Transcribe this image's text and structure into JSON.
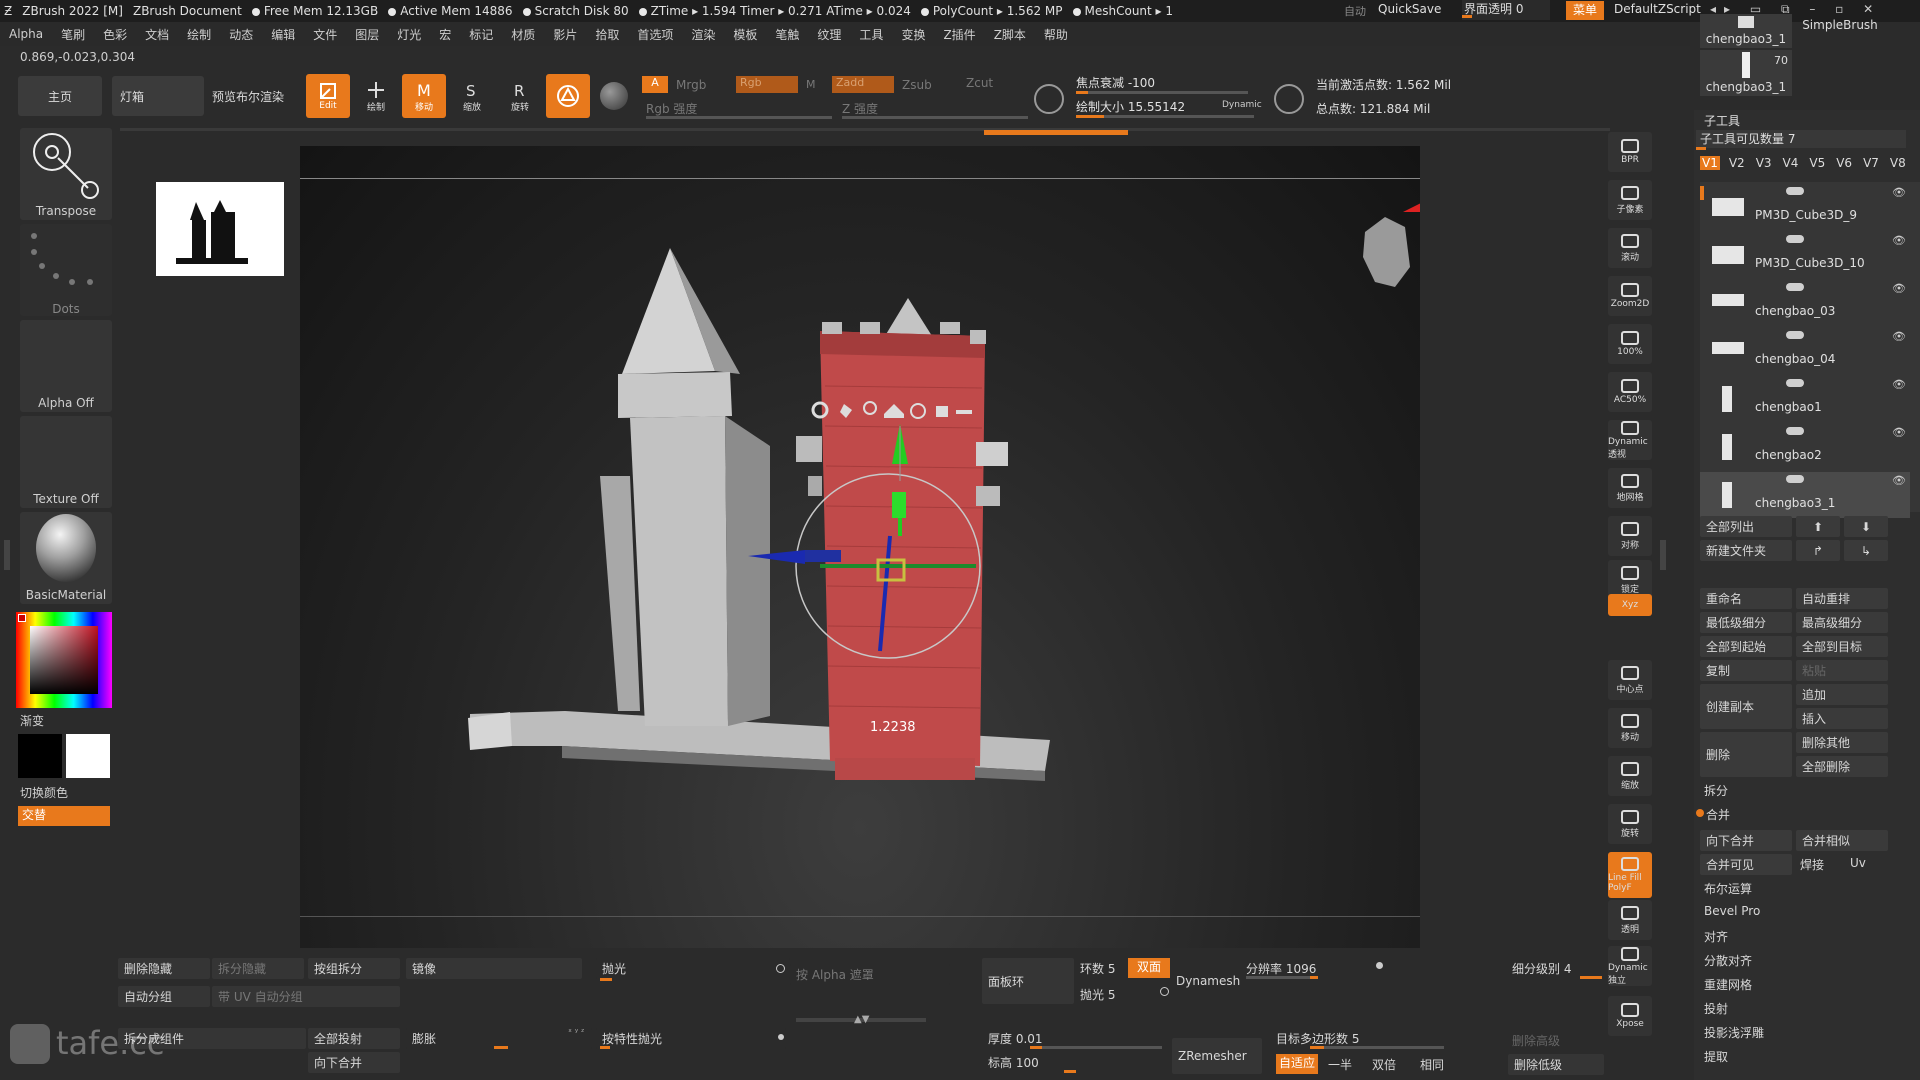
{
  "titlebar": {
    "app": "ZBrush 2022 [M]",
    "doc": "ZBrush Document",
    "free_mem": "Free Mem 12.13GB",
    "active_mem": "Active Mem 14886",
    "scratch": "Scratch Disk 80",
    "ztime": "ZTime ▸ 1.594 Timer ▸ 0.271 ATime ▸ 0.024",
    "polycount": "PolyCount ▸ 1.562 MP",
    "meshcount": "MeshCount ▸ 1",
    "auto": "自动",
    "quicksave": "QuickSave",
    "ui_opacity": "界面透明 0",
    "menu": "菜单",
    "script": "DefaultZScript"
  },
  "menus": [
    "Alpha",
    "笔刷",
    "色彩",
    "文档",
    "绘制",
    "动态",
    "编辑",
    "文件",
    "图层",
    "灯光",
    "宏",
    "标记",
    "材质",
    "影片",
    "拾取",
    "首选项",
    "渲染",
    "模板",
    "笔触",
    "纹理",
    "工具",
    "变换",
    "Z插件",
    "Z脚本",
    "帮助"
  ],
  "coords": "0.869,-0.023,0.304",
  "shelf": {
    "home": "主页",
    "lightbox": "灯箱",
    "bpr": "预览布尔渲染",
    "edit": "Edit",
    "draw": "绘制",
    "move": "移动",
    "scale": "缩放",
    "rotate": "旋转",
    "a": "A",
    "mrgb": "Mrgb",
    "rgb": "Rgb",
    "m": "M",
    "zadd": "Zadd",
    "zsub": "Zsub",
    "zcut": "Zcut",
    "rgb_intensity": "Rgb 强度",
    "z_intensity": "Z 强度",
    "focal_shift": "焦点衰减 -100",
    "draw_size": "绘制大小 15.55142",
    "dynamic": "Dynamic",
    "active_points": "当前激活点数: 1.562 Mil",
    "total_points": "总点数: 121.884 Mil"
  },
  "left_panel": {
    "transpose": "Transpose",
    "dots": "Dots",
    "alpha_off": "Alpha Off",
    "texture_off": "Texture Off",
    "material": "BasicMaterial",
    "gradient": "渐变",
    "switch_color": "切换颜色",
    "alternate": "交替"
  },
  "viewport": {
    "gizmo_value": "1.2238"
  },
  "right_column": [
    "BPR",
    "子像素",
    "滚动",
    "Zoom2D",
    "100%",
    "AC50%",
    "Dynamic 透视",
    "地网格",
    "对称",
    "锁定",
    "Xyz",
    "中心点",
    "移动",
    "缩放",
    "旋转",
    "Line Fill PolyF",
    "透明",
    "Dynamic 独立",
    "Xpose"
  ],
  "top_right": {
    "brush1": "chengbao3_1",
    "brush2": "SimpleBrush",
    "brush3": "chengbao3_1",
    "count": "70"
  },
  "subtool": {
    "header": "子工具",
    "visible_count": "子工具可见数量 7",
    "versions": [
      "V1",
      "V2",
      "V3",
      "V4",
      "V5",
      "V6",
      "V7",
      "V8"
    ],
    "items": [
      "PM3D_Cube3D_9",
      "PM3D_Cube3D_10",
      "chengbao_03",
      "chengbao_04",
      "chengbao1",
      "chengbao2",
      "chengbao3_1"
    ],
    "list_all": "全部列出",
    "new_folder": "新建文件夹",
    "rename": "重命名",
    "auto_reorder": "自动重排",
    "lowest_sub": "最低级细分",
    "highest_sub": "最高级细分",
    "all_low": "全部到起始",
    "all_high": "全部到目标",
    "copy": "复制",
    "paste": "粘贴",
    "duplicate": "创建副本",
    "append": "追加",
    "insert": "插入",
    "delete": "删除",
    "delete_other": "删除其他",
    "delete_all": "全部删除",
    "split": "拆分",
    "merge": "合并",
    "merge_down": "向下合并",
    "merge_similar": "合并相似",
    "merge_visible": "合并可见",
    "weld": "焊接",
    "uv": "Uv",
    "boolean": "布尔运算",
    "bevel": "Bevel Pro",
    "align": "对齐",
    "distribute": "分散对齐",
    "remesh": "重建网格",
    "project": "投射",
    "extract_shallow": "投影浅浮雕",
    "extract": "提取"
  },
  "bottom": {
    "del_hidden": "删除隐藏",
    "split_hidden": "拆分隐藏",
    "groups_split": "按组拆分",
    "mirror": "镜像",
    "polish": "抛光",
    "alpha_mask": "按 Alpha 遮罩",
    "panel_loops": "面板环",
    "loops": "环数 5",
    "double": "双面",
    "polish5": "抛光 5",
    "dynamesh": "Dynamesh",
    "resolution": "分辨率 1096",
    "sub_level": "细分级别 4",
    "auto_groups": "自动分组",
    "uv_groups": "带 UV 自动分组",
    "split_unmasked": "拆分成组件",
    "project_all": "全部投射",
    "inflate": "膨胀",
    "polish_feature": "按特性抛光",
    "thickness": "厚度 0.01",
    "zremesher": "ZRemesher",
    "target_poly": "目标多边形数 5",
    "del_higher": "删除高级",
    "merge_down2": "向下合并",
    "elevation": "标高 100",
    "adapt": "自适应",
    "half": "一半",
    "double2": "双倍",
    "same": "相同",
    "del_lower": "删除低级",
    "watermark": "tafe.cc"
  },
  "colors": {
    "accent": "#e8791c",
    "panel": "#2e2e2e",
    "brick": "#b84848"
  }
}
